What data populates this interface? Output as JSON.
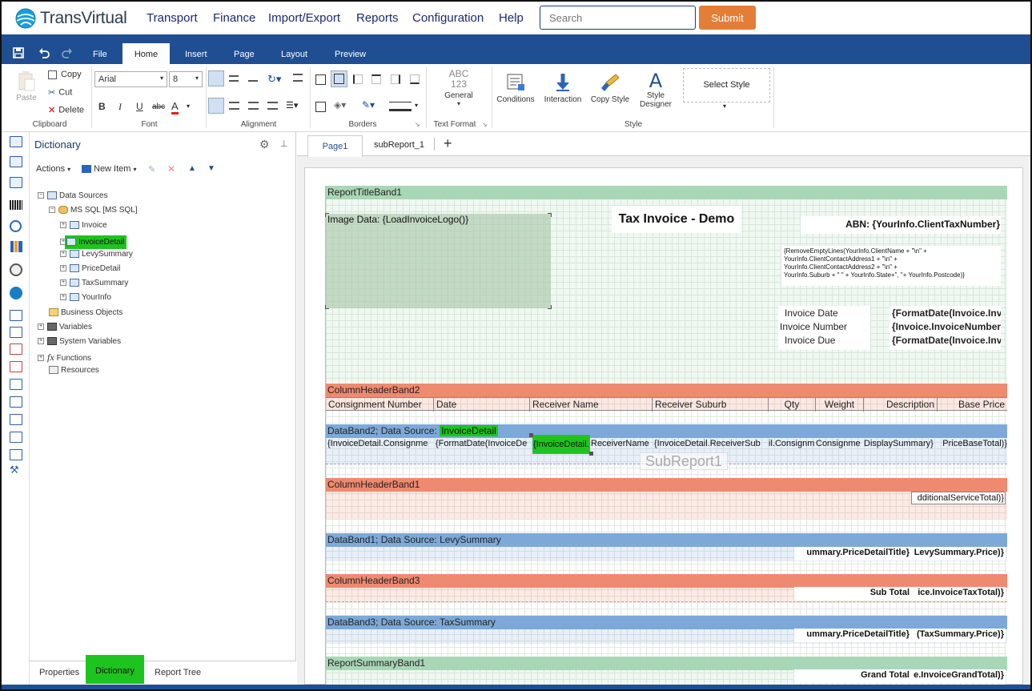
{
  "brand": {
    "name": "TransVirtual"
  },
  "nav": {
    "items": [
      "Transport",
      "Finance",
      "Import/Export",
      "Reports",
      "Configuration",
      "Help"
    ]
  },
  "search": {
    "placeholder": "Search"
  },
  "submit_label": "Submit",
  "ribbon_tabs": [
    "File",
    "Home",
    "Insert",
    "Page",
    "Layout",
    "Preview"
  ],
  "ribbon": {
    "clipboard": {
      "paste": "Paste",
      "copy": "Copy",
      "cut": "Cut",
      "delete": "Delete",
      "label": "Clipboard"
    },
    "font": {
      "name": "Arial",
      "size": "8",
      "label": "Font"
    },
    "alignment": {
      "label": "Alignment"
    },
    "borders": {
      "label": "Borders"
    },
    "text_format": {
      "abc": "ABC",
      "nums": "123",
      "general": "General",
      "label": "Text Format"
    },
    "style": {
      "conditions": "Conditions",
      "interaction": "Interaction",
      "copy_style": "Copy Style",
      "style_designer_1": "Style",
      "style_designer_2": "Designer",
      "select_style": "Select Style",
      "label": "Style"
    }
  },
  "dictionary": {
    "title": "Dictionary",
    "actions": "Actions",
    "new_item": "New Item",
    "tree": {
      "data_sources": "Data Sources",
      "connection": "MS SQL [MS SQL]",
      "tables": [
        "Invoice",
        "InvoiceDetail",
        "LevySummary",
        "PriceDetail",
        "TaxSummary",
        "YourInfo"
      ],
      "business_objects": "Business Objects",
      "variables": "Variables",
      "system_variables": "System Variables",
      "functions": "Functions",
      "resources": "Resources"
    }
  },
  "bottom_tabs": [
    "Properties",
    "Dictionary",
    "Report Tree"
  ],
  "page_tabs": [
    "Page1",
    "subReport_1"
  ],
  "report": {
    "title_band": "ReportTitleBand1",
    "image_data": "Image Data: {LoadInvoiceLogo()}",
    "tax_invoice": "Tax Invoice - Demo",
    "abn": "ABN: {YourInfo.ClientTaxNumber}",
    "address_lines": [
      "{RemoveEmptyLines(YourInfo.ClientName + \"\\n\" +",
      "YourInfo.ClientContactAddress1 + \"\\n\" +",
      "YourInfo.ClientContactAddress2 + \"\\n\" +",
      "YourInfo.Suburb + \" \" + YourInfo.State+\", \"+ YourInfo.Postcode)}"
    ],
    "invoice_date": "Invoice Date",
    "invoice_number": "Invoice Number",
    "invoice_due": "Invoice Due",
    "invoice_date_val": "{FormatDate(Invoice.Inv",
    "invoice_number_val": "{Invoice.InvoiceNumber",
    "invoice_due_val": "{FormatDate(Invoice.Inv",
    "col_header_band2": "ColumnHeaderBand2",
    "columns": [
      "Consignment Number",
      "Date",
      "Receiver Name",
      "Receiver Suburb",
      "Qty",
      "Weight",
      "Description",
      "Base Price"
    ],
    "data_band2_prefix": "DataBand2; Data Source: ",
    "data_band2_source": "InvoiceDetail",
    "data_cells": [
      "{InvoiceDetail.Consignme",
      "{FormatDate(InvoiceDe",
      "{InvoiceDetail.",
      "ReceiverName",
      "{InvoiceDetail.ReceiverSub",
      "il.Consignm",
      "Consignme",
      "DisplaySummary}",
      "PriceBaseTotal)}"
    ],
    "subreport": "SubReport1",
    "col_header_band1": "ColumnHeaderBand1",
    "additional_service": "dditionalServiceTotal)}",
    "data_band1": "DataBand1; Data Source: LevySummary",
    "levy_title": "ummary.PriceDetailTitle}",
    "levy_price": "LevySummary.Price)}",
    "col_header_band3": "ColumnHeaderBand3",
    "sub_total": "Sub Total",
    "tax_total": "ice.InvoiceTaxTotal)}",
    "data_band3": "DataBand3; Data Source: TaxSummary",
    "tax_title": "ummary.PriceDetailTitle}",
    "tax_price": "(TaxSummary.Price)}",
    "summary_band": "ReportSummaryBand1",
    "grand_total": "Grand Total",
    "grand_total_val": "e.InvoiceGrandTotal)}"
  },
  "colors": {
    "nav_blue": "#1f4e92",
    "submit_orange": "#e47e37",
    "highlight_green": "#1ec41e",
    "band_green": "#a9d6b6",
    "band_red": "#ee8a6f",
    "band_blue": "#7da9d8"
  }
}
